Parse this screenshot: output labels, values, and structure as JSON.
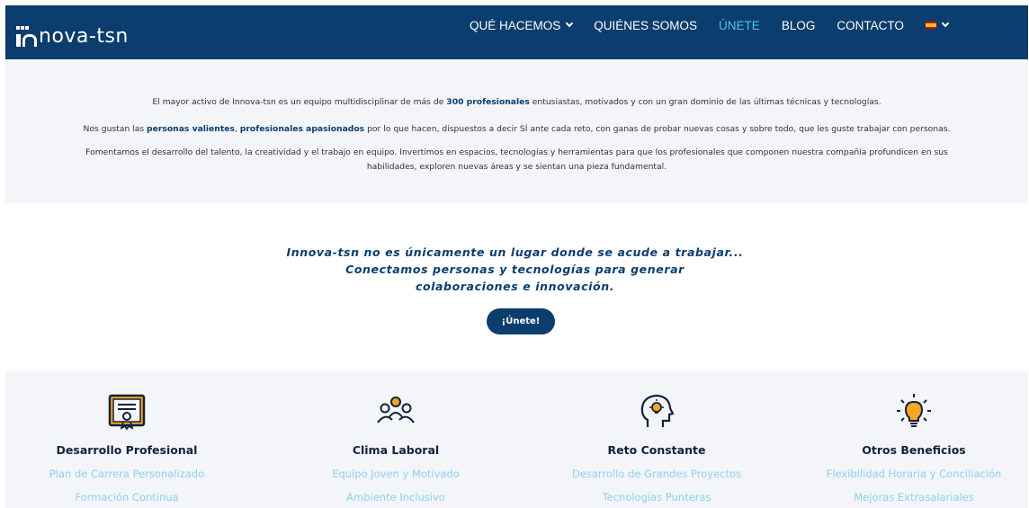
{
  "header": {
    "logo_text": "nova-tsn",
    "nav": [
      {
        "label": "QUÉ HACEMOS",
        "dropdown": true,
        "active": false
      },
      {
        "label": "QUIÉNES SOMOS",
        "dropdown": false,
        "active": false
      },
      {
        "label": "ÚNETE",
        "dropdown": false,
        "active": true
      },
      {
        "label": "BLOG",
        "dropdown": false,
        "active": false
      },
      {
        "label": "CONTACTO",
        "dropdown": false,
        "active": false
      }
    ],
    "language_icon": "spain-flag-icon"
  },
  "intro": {
    "p1": {
      "a": "El mayor activo de Innova-tsn es un equipo multidisciplinar de más de ",
      "b": "300 profesionales",
      "c": " entusiastas, motivados y con un gran dominio de las últimas técnicas y tecnologías."
    },
    "p2": {
      "a": "Nos gustan las ",
      "b": "personas valientes",
      "c": ", ",
      "d": "profesionales apasionados",
      "e": " por lo que hacen, dispuestos a decir SÍ ante cada reto, con ganas de probar nuevas cosas y sobre todo, que les guste trabajar con personas."
    },
    "p3": "Fomentamos el desarrollo del talento, la creatividad y el trabajo en equipo. Invertimos en espacios, tecnologías y herramientas para que los profesionales que componen nuestra compañía profundicen en sus habilidades, exploren nuevas áreas y se sientan una pieza fundamental."
  },
  "tagline": {
    "line1": "Innova-tsn no es únicamente un lugar donde se acude a trabajar...",
    "line2": "Conectamos personas y tecnologías para generar",
    "line3": "colaboraciones e innovación."
  },
  "join_button": "¡Únete!",
  "features": [
    {
      "icon": "certificate-icon",
      "title": "Desarrollo Profesional",
      "items": [
        "Plan de Carrera Personalizado",
        "Formación Continua"
      ]
    },
    {
      "icon": "team-icon",
      "title": "Clima Laboral",
      "items": [
        "Equipo Joven y Motivado",
        "Ambiente Inclusivo"
      ]
    },
    {
      "icon": "head-lightbulb-icon",
      "title": "Reto Constante",
      "items": [
        "Desarrollo de Grandes Proyectos",
        "Tecnologías Punteras"
      ]
    },
    {
      "icon": "lightbulb-icon",
      "title": "Otros Beneficios",
      "items": [
        "Flexibilidad Horaria y Conciliación",
        "Mejoras Extrasalariales"
      ]
    }
  ],
  "colors": {
    "brand_navy": "#0b3d6e",
    "active_nav": "#4ec3f0",
    "link_light_blue": "#8fd0f0",
    "section_bg": "#f3f5f8"
  }
}
